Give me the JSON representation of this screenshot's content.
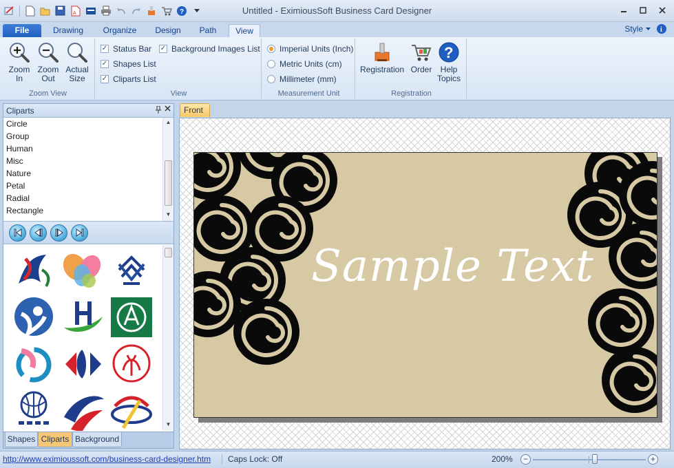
{
  "window": {
    "title": "Untitled - EximiousSoft Business Card Designer"
  },
  "tabs": [
    "File",
    "Drawing",
    "Organize",
    "Design",
    "Path",
    "View"
  ],
  "active_tab": "View",
  "style_menu": "Style",
  "ribbon": {
    "zoom_view": {
      "label": "Zoom View",
      "zoom_in": "Zoom In",
      "zoom_out": "Zoom Out",
      "actual_size": "Actual Size"
    },
    "view": {
      "label": "View",
      "status_bar": "Status Bar",
      "shapes_list": "Shapes List",
      "cliparts_list": "Cliparts List",
      "background_images_list": "Background Images List",
      "status_bar_checked": true,
      "shapes_list_checked": true,
      "cliparts_list_checked": true,
      "background_images_list_checked": true
    },
    "measurement": {
      "label": "Measurement Unit",
      "imperial": "Imperial Units (Inch)",
      "metric": "Metric Units (cm)",
      "millimeter": "Millimeter (mm)",
      "selected": "imperial"
    },
    "registration": {
      "label": "Registration",
      "registration": "Registration",
      "order": "Order",
      "help": "Help Topics"
    }
  },
  "left_panel": {
    "title": "Cliparts",
    "categories": [
      "Circle",
      "Group",
      "Human",
      "Misc",
      "Nature",
      "Petal",
      "Radial",
      "Rectangle"
    ],
    "bottom_tabs": [
      "Shapes",
      "Cliparts",
      "Background"
    ],
    "active_tab": "Cliparts"
  },
  "document": {
    "tab": "Front",
    "card_text": "Sample Text",
    "card_bg": "#d6c9a3"
  },
  "status_bar": {
    "url": "http://www.eximioussoft.com/business-card-designer.htm",
    "caps": "Caps Lock: Off",
    "zoom": "200%",
    "zoom_level": 0.55
  }
}
